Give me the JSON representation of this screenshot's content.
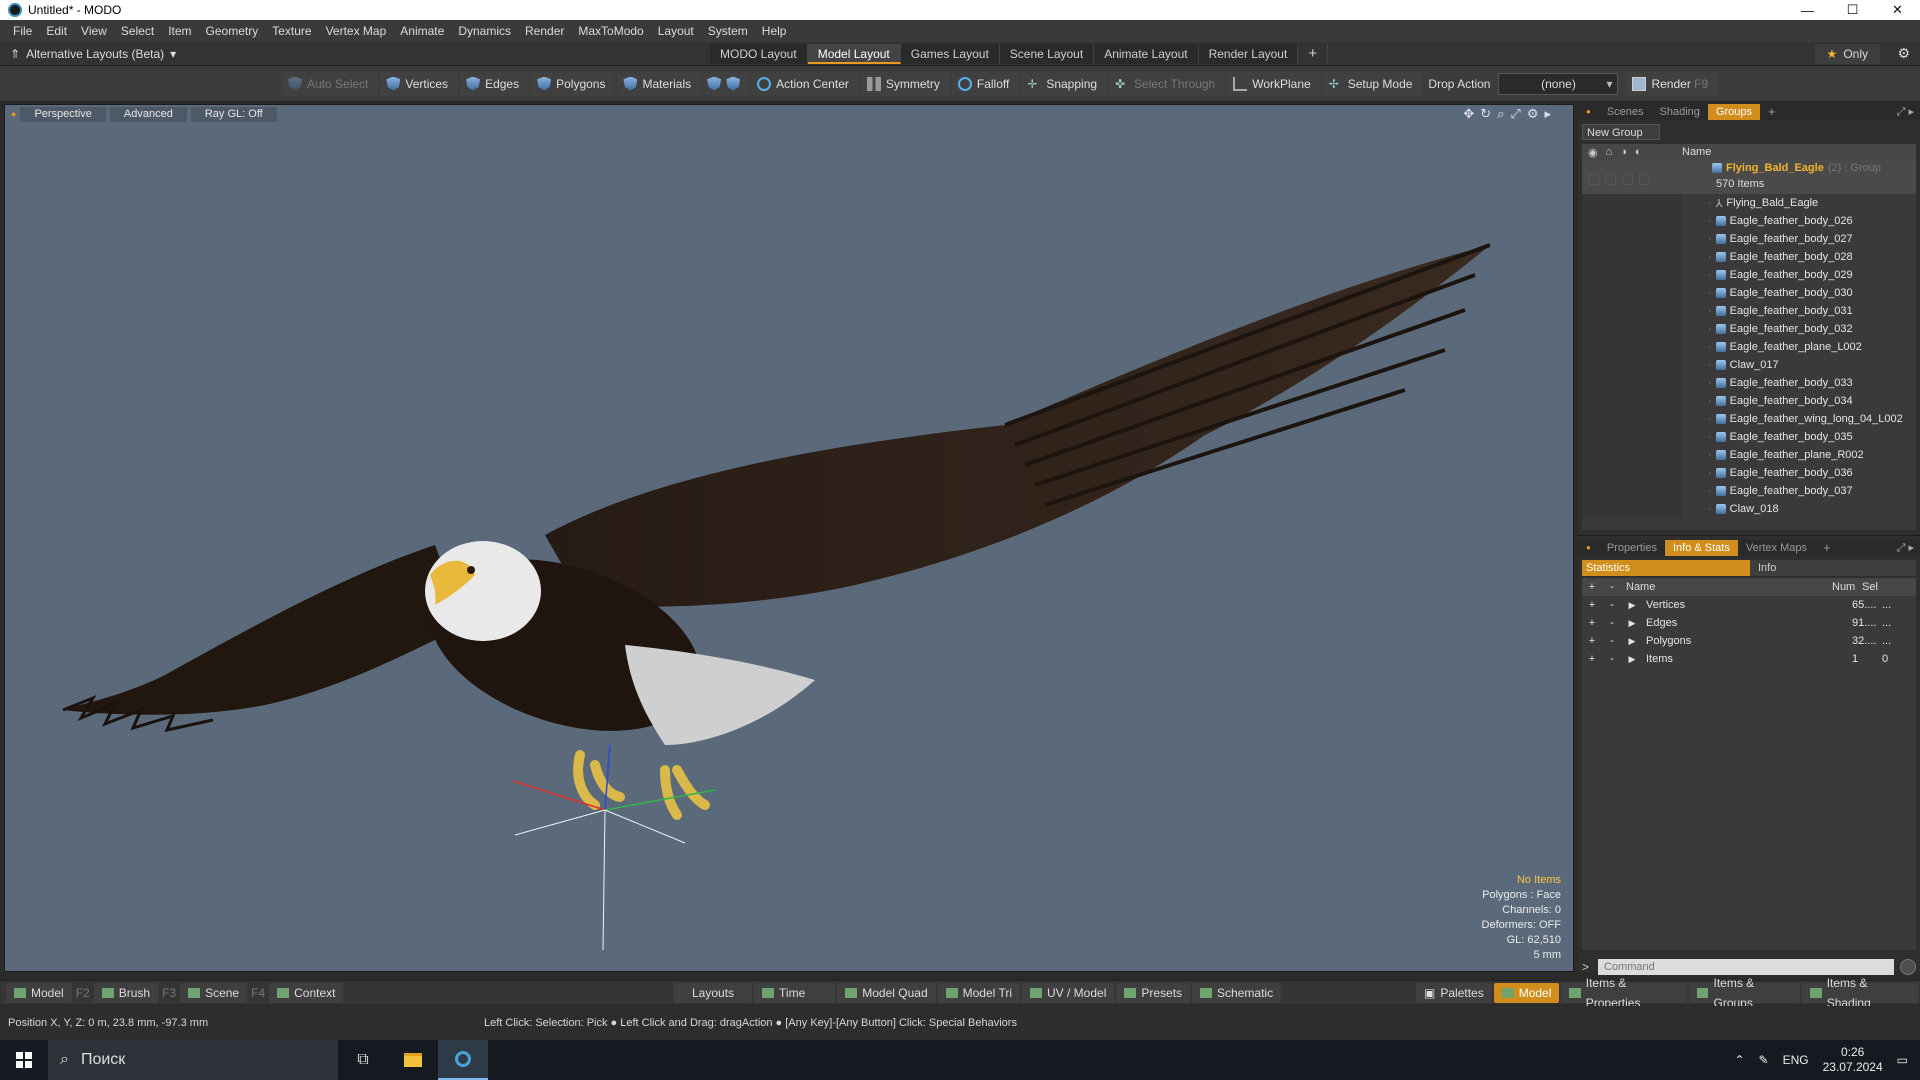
{
  "window": {
    "title": "Untitled* - MODO",
    "controls": [
      "—",
      "☐",
      "✕"
    ]
  },
  "menu": [
    "File",
    "Edit",
    "View",
    "Select",
    "Item",
    "Geometry",
    "Texture",
    "Vertex Map",
    "Animate",
    "Dynamics",
    "Render",
    "MaxToModo",
    "Layout",
    "System",
    "Help"
  ],
  "layoutbar": {
    "alt_layouts": "Alternative Layouts (Beta)",
    "tabs": [
      "MODO Layout",
      "Model Layout",
      "Games Layout",
      "Scene Layout",
      "Animate Layout",
      "Render Layout"
    ],
    "active_tab": "Model Layout",
    "only_label": "Only"
  },
  "toolbar": {
    "auto_select": "Auto Select",
    "vertices": "Vertices",
    "edges": "Edges",
    "polygons": "Polygons",
    "materials": "Materials",
    "action_center": "Action Center",
    "symmetry": "Symmetry",
    "falloff": "Falloff",
    "snapping": "Snapping",
    "select_through": "Select Through",
    "workplane": "WorkPlane",
    "setup_mode": "Setup Mode",
    "drop_action_label": "Drop Action",
    "drop_action_value": "(none)",
    "render": "Render",
    "render_key": "F9"
  },
  "viewport": {
    "tabs": [
      "Perspective",
      "Advanced",
      "Ray GL: Off"
    ],
    "info": {
      "no_items": "No Items",
      "polygons": "Polygons : Face",
      "channels": "Channels: 0",
      "deformers": "Deformers: OFF",
      "gl": "GL: 62,510",
      "scale": "5 mm"
    },
    "colors": {
      "background": "#5b6a7a",
      "x_axis": "#e0302a",
      "y_axis": "#2fb54a",
      "z_axis": "#2a47d8"
    }
  },
  "groups_panel": {
    "tabs": [
      "Scenes",
      "Shading",
      "Groups"
    ],
    "active_tab": "Groups",
    "new_group": "New Group",
    "column_name": "Name",
    "group": {
      "name": "Flying_Bald_Eagle",
      "suffix": "(2) : Group",
      "count": "570 Items"
    },
    "items": [
      {
        "label": "Flying_Bald_Eagle",
        "icon": "locator-icon"
      },
      {
        "label": "Eagle_feather_body_026",
        "icon": "mesh-icon"
      },
      {
        "label": "Eagle_feather_body_027",
        "icon": "mesh-icon"
      },
      {
        "label": "Eagle_feather_body_028",
        "icon": "mesh-icon"
      },
      {
        "label": "Eagle_feather_body_029",
        "icon": "mesh-icon"
      },
      {
        "label": "Eagle_feather_body_030",
        "icon": "mesh-icon"
      },
      {
        "label": "Eagle_feather_body_031",
        "icon": "mesh-icon"
      },
      {
        "label": "Eagle_feather_body_032",
        "icon": "mesh-icon"
      },
      {
        "label": "Eagle_feather_plane_L002",
        "icon": "mesh-icon"
      },
      {
        "label": "Claw_017",
        "icon": "mesh-icon"
      },
      {
        "label": "Eagle_feather_body_033",
        "icon": "mesh-icon"
      },
      {
        "label": "Eagle_feather_body_034",
        "icon": "mesh-icon"
      },
      {
        "label": "Eagle_feather_wing_long_04_L002",
        "icon": "mesh-icon"
      },
      {
        "label": "Eagle_feather_body_035",
        "icon": "mesh-icon"
      },
      {
        "label": "Eagle_feather_plane_R002",
        "icon": "mesh-icon"
      },
      {
        "label": "Eagle_feather_body_036",
        "icon": "mesh-icon"
      },
      {
        "label": "Eagle_feather_body_037",
        "icon": "mesh-icon"
      },
      {
        "label": "Claw_018",
        "icon": "mesh-icon"
      }
    ]
  },
  "props_panel": {
    "tabs": [
      "Properties",
      "Info & Stats",
      "Vertex Maps"
    ],
    "active_tab": "Info & Stats",
    "sub_tabs": [
      "Statistics",
      "Info"
    ],
    "columns": {
      "name": "Name",
      "num": "Num",
      "sel": "Sel"
    },
    "rows": [
      {
        "name": "Vertices",
        "num": "65....",
        "sel": "..."
      },
      {
        "name": "Edges",
        "num": "91....",
        "sel": "..."
      },
      {
        "name": "Polygons",
        "num": "32....",
        "sel": "..."
      },
      {
        "name": "Items",
        "num": "1",
        "sel": "0"
      }
    ],
    "command_placeholder": "Command"
  },
  "bottombar": {
    "model": "Model",
    "model_key": "F2",
    "brush": "Brush",
    "brush_key": "F3",
    "scene": "Scene",
    "scene_key": "F4",
    "context": "Context",
    "layouts": "Layouts",
    "time": "Time",
    "model_quad": "Model Quad",
    "model_tri": "Model Tri",
    "uv_model": "UV / Model",
    "presets": "Presets",
    "schematic": "Schematic",
    "palettes": "Palettes",
    "model_active": "Model",
    "items_props": "Items & Properties",
    "items_groups": "Items & Groups",
    "items_shading": "Items & Shading"
  },
  "status": {
    "position": "Position X, Y, Z:  0 m, 23.8 mm, -97.3 mm",
    "hint": "Left Click: Selection: Pick ● Left Click and Drag: dragAction ● [Any Key]-[Any Button] Click: Special Behaviors"
  },
  "taskbar": {
    "search": "Поиск",
    "lang": "ENG",
    "time": "0:26",
    "date": "23.07.2024"
  }
}
